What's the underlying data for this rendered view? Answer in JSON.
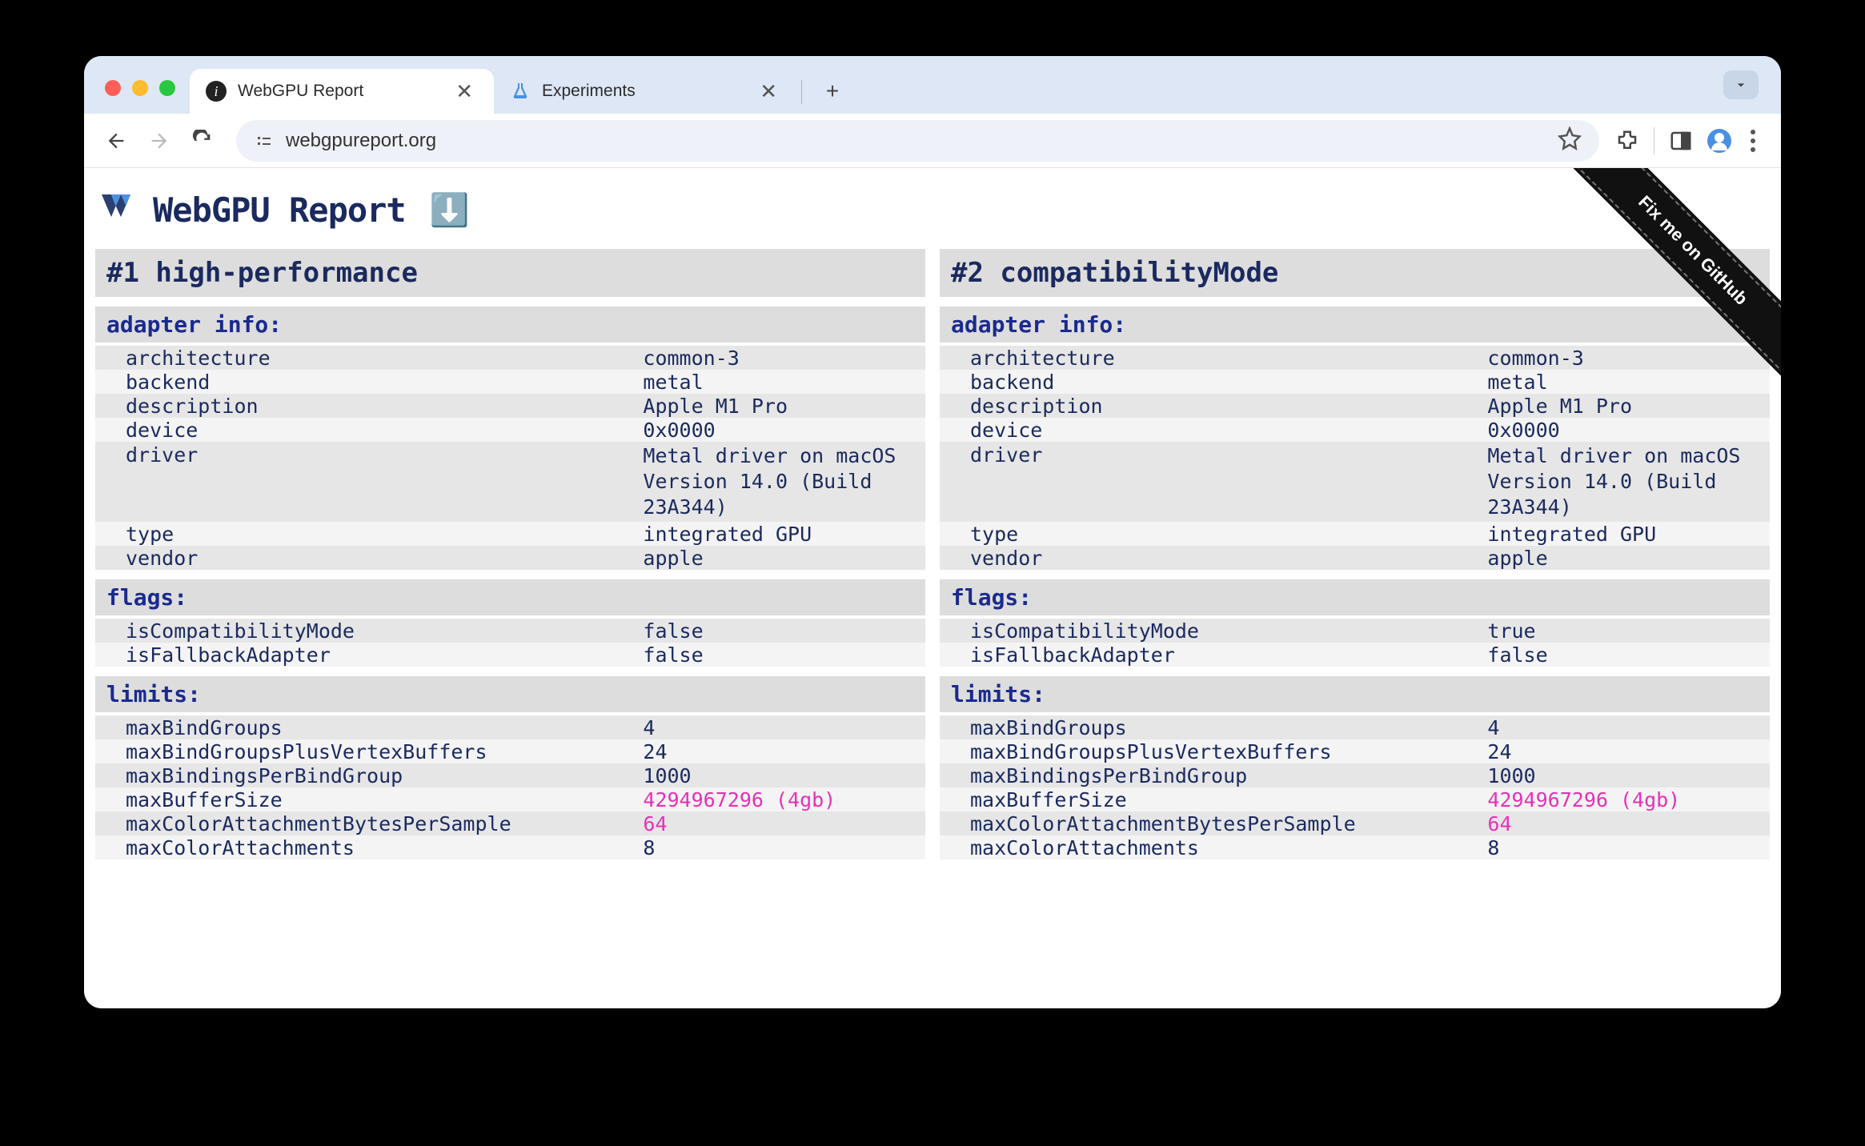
{
  "browser": {
    "tabs": [
      {
        "title": "WebGPU Report",
        "active": true
      },
      {
        "title": "Experiments",
        "active": false
      }
    ],
    "url": "webgpureport.org"
  },
  "page": {
    "title": "WebGPU Report",
    "github_ribbon": "Fix me on GitHub"
  },
  "columns": [
    {
      "header": "#1 high-performance",
      "sections": [
        {
          "title": "adapter info:",
          "rows": [
            {
              "key": "architecture",
              "val": "common-3"
            },
            {
              "key": "backend",
              "val": "metal"
            },
            {
              "key": "description",
              "val": "Apple M1 Pro"
            },
            {
              "key": "device",
              "val": "0x0000"
            },
            {
              "key": "driver",
              "val": "Metal driver on macOS Version 14.0 (Build 23A344)",
              "multiline": true
            },
            {
              "key": "type",
              "val": "integrated GPU"
            },
            {
              "key": "vendor",
              "val": "apple"
            }
          ]
        },
        {
          "title": "flags:",
          "rows": [
            {
              "key": "isCompatibilityMode",
              "val": "false"
            },
            {
              "key": "isFallbackAdapter",
              "val": "false"
            }
          ]
        },
        {
          "title": "limits:",
          "rows": [
            {
              "key": "maxBindGroups",
              "val": "4"
            },
            {
              "key": "maxBindGroupsPlusVertexBuffers",
              "val": "24"
            },
            {
              "key": "maxBindingsPerBindGroup",
              "val": "1000"
            },
            {
              "key": "maxBufferSize",
              "val": "4294967296 (4gb)",
              "highlight": true
            },
            {
              "key": "maxColorAttachmentBytesPerSample",
              "val": "64",
              "highlight": true
            },
            {
              "key": "maxColorAttachments",
              "val": "8"
            }
          ]
        }
      ]
    },
    {
      "header": "#2 compatibilityMode",
      "sections": [
        {
          "title": "adapter info:",
          "rows": [
            {
              "key": "architecture",
              "val": "common-3"
            },
            {
              "key": "backend",
              "val": "metal"
            },
            {
              "key": "description",
              "val": "Apple M1 Pro"
            },
            {
              "key": "device",
              "val": "0x0000"
            },
            {
              "key": "driver",
              "val": "Metal driver on macOS Version 14.0 (Build 23A344)",
              "multiline": true
            },
            {
              "key": "type",
              "val": "integrated GPU"
            },
            {
              "key": "vendor",
              "val": "apple"
            }
          ]
        },
        {
          "title": "flags:",
          "rows": [
            {
              "key": "isCompatibilityMode",
              "val": "true"
            },
            {
              "key": "isFallbackAdapter",
              "val": "false"
            }
          ]
        },
        {
          "title": "limits:",
          "rows": [
            {
              "key": "maxBindGroups",
              "val": "4"
            },
            {
              "key": "maxBindGroupsPlusVertexBuffers",
              "val": "24"
            },
            {
              "key": "maxBindingsPerBindGroup",
              "val": "1000"
            },
            {
              "key": "maxBufferSize",
              "val": "4294967296 (4gb)",
              "highlight": true
            },
            {
              "key": "maxColorAttachmentBytesPerSample",
              "val": "64",
              "highlight": true
            },
            {
              "key": "maxColorAttachments",
              "val": "8"
            }
          ]
        }
      ]
    }
  ]
}
